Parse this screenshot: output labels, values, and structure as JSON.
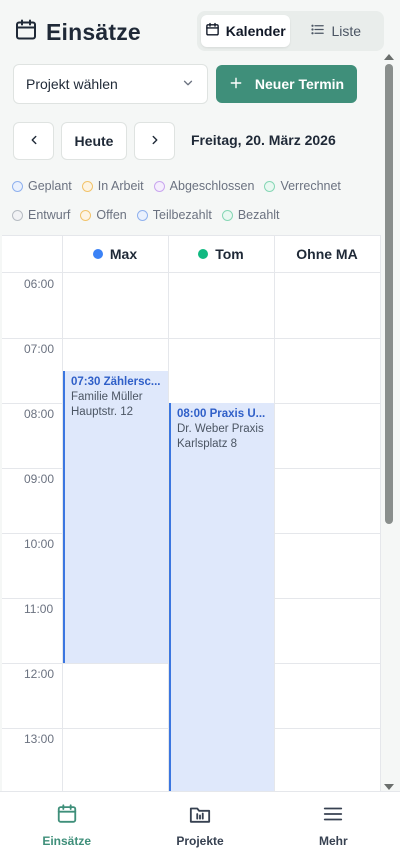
{
  "header": {
    "title": "Einsätze",
    "title_icon": "calendar-icon",
    "view_toggle": [
      {
        "label": "Kalender",
        "icon": "calendar-icon",
        "active": true
      },
      {
        "label": "Liste",
        "icon": "list-icon",
        "active": false
      }
    ]
  },
  "toolbar": {
    "project_select_value": "Projekt wählen",
    "new_button_label": "Neuer Termin",
    "new_button_icon": "plus-icon",
    "accent_color": "#3f8f7a"
  },
  "date_nav": {
    "prev_icon": "chevron-left-icon",
    "today_label": "Heute",
    "next_icon": "chevron-right-icon",
    "current_date": "Freitag, 20. März 2026"
  },
  "legend": {
    "row1": [
      {
        "label": "Geplant",
        "color": "#3b82f6"
      },
      {
        "label": "In Arbeit",
        "color": "#f59e0b"
      },
      {
        "label": "Abgeschlossen",
        "color": "#a855f7"
      },
      {
        "label": "Verrechnet",
        "color": "#10b981"
      }
    ],
    "row2": [
      {
        "label": "Entwurf",
        "color": "#9ca3af"
      },
      {
        "label": "Offen",
        "color": "#f59e0b"
      },
      {
        "label": "Teilbezahlt",
        "color": "#3b82f6"
      },
      {
        "label": "Bezahlt",
        "color": "#10b981"
      }
    ]
  },
  "calendar": {
    "columns": [
      {
        "name": "Max",
        "color": "#3b82f6"
      },
      {
        "name": "Tom",
        "color": "#10b981"
      },
      {
        "name": "Ohne MA",
        "color": ""
      }
    ],
    "hours": [
      "06:00",
      "07:00",
      "08:00",
      "09:00",
      "10:00",
      "11:00",
      "12:00",
      "13:00"
    ],
    "events": [
      {
        "title": "07:30 Zählersc...",
        "client": "Familie Müller",
        "address": "Hauptstr. 12",
        "status_color": "#3b82f6"
      },
      {
        "title": "08:00 Praxis U...",
        "client": "Dr. Weber Praxis",
        "address": "Karlsplatz 8",
        "status_color": "#3b82f6"
      }
    ]
  },
  "bottom_nav": [
    {
      "label": "Einsätze",
      "icon": "calendar-icon",
      "active": true
    },
    {
      "label": "Projekte",
      "icon": "folder-icon",
      "active": false
    },
    {
      "label": "Mehr",
      "icon": "menu-icon",
      "active": false
    }
  ]
}
